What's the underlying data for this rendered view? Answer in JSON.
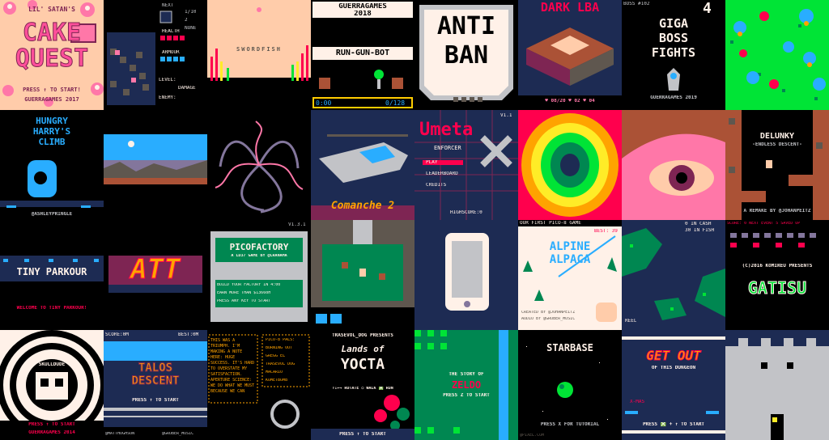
{
  "carts": [
    {
      "id": "cake-quest",
      "title_top": "LIL' SATAN'S",
      "title_a": "CAKE",
      "title_b": "QUEST",
      "prompt": "PRESS ↑ TO START!",
      "credit": "GUERRAGAMES 2017",
      "colors": {
        "bg": "#ff9ec1",
        "title": "#ff4f9a"
      }
    },
    {
      "id": "puzzle-hud",
      "next": "NEXT",
      "count": "1/10",
      "two": "2",
      "none": "NONE",
      "health": "HEALTH",
      "armour": "ARMOUR",
      "level": "LEVEL:",
      "damage": "DAMAGE",
      "enemy": "ENEMY:"
    },
    {
      "id": "swordfish",
      "title": "SWORDFISH",
      "colors": {
        "bg": "#ffc9a8"
      }
    },
    {
      "id": "run-gun-bot",
      "title_a": "GUERRAGAMES",
      "title_b": "2018",
      "subtitle": "RUN-GUN-BOT",
      "score_left": "0:00",
      "score_right": "0/128",
      "colors": {
        "accent": "#ffcc00"
      }
    },
    {
      "id": "anti-ban",
      "title_a": "ANTI",
      "title_b": "BAN",
      "colors": {
        "bg": "#c2c3c7"
      }
    },
    {
      "id": "dark-lba",
      "title": "DARK LBA",
      "hud": "♥ 08/20 ♥ 02 ♥ 04",
      "colors": {
        "title": "#ff004d"
      }
    },
    {
      "id": "giga-boss-fights",
      "corner": "BOSS #102",
      "big": "4",
      "title_a": "GIGA",
      "title_b": "BOSS",
      "title_c": "FIGHTS",
      "credit": "GUERRAGAMES 2019"
    },
    {
      "id": "orbs",
      "colors": {
        "bg": "#00e436"
      }
    },
    {
      "id": "hungry-harry",
      "title_a": "HUNGRY",
      "title_b": "HARRY'S",
      "title_c": "CLIMB",
      "credit": "@ASHLEYPRINGLE"
    },
    {
      "id": "desert-night",
      "colors": {
        "sky": "#29adff"
      }
    },
    {
      "id": "worms",
      "colors": {
        "bg": "#000000"
      }
    },
    {
      "id": "comanche",
      "title": "Comanche 2",
      "colors": {
        "bg": "#1d2b53"
      }
    },
    {
      "id": "umeta-enforcer",
      "title": "Umeta",
      "subtitle": "ENFORCER",
      "version": "V1.1",
      "menu": [
        "PLAY",
        "LEADERBOARD",
        "CREDITS"
      ],
      "highscore": "HIGHSCORE:0"
    },
    {
      "id": "psychedelic",
      "colors": {
        "bg": "#ff004d"
      }
    },
    {
      "id": "eye",
      "colors": {
        "bg": "#ff77a8"
      }
    },
    {
      "id": "delunky",
      "title": "DELUNKY",
      "subtitle": "-ENDLESS DESCENT-",
      "credit": "A REMAKE BY @JOHANPEITZ"
    },
    {
      "id": "tiny-parkour",
      "title": "TINY PARKOUR",
      "welcome": "WELCOME TO TINY PARKOUR!"
    },
    {
      "id": "att",
      "title": "ATT"
    },
    {
      "id": "picofactory",
      "version": "V1.3.1",
      "title": "PICOFACTORY",
      "subtitle": "A LD37 GAME BY @CRANAMA",
      "desc_a": "BUILD YOUR FACTORY IN 4:00",
      "desc_b": "EARN MORE THAN $13660H",
      "desc_c": "PRESS ANY KEY TO START"
    },
    {
      "id": "topdown-dungeon",
      "colors": {
        "bg": "#008751"
      }
    },
    {
      "id": "phone",
      "colors": {
        "bg": "#1d2b53"
      }
    },
    {
      "id": "alpine-alpaca",
      "ticker": "OUR FIRST PICO-8 GAME",
      "best": "BEST: 39",
      "title_a": "ALPINE",
      "title_b": "ALPACA",
      "credit_a": "CREATED BY @JOHANPEITZ",
      "credit_b": "AUDIO BY @GRUBER_MUSIC"
    },
    {
      "id": "fishing",
      "line_a": "0 IN CASH",
      "line_b": "30 IN FISH",
      "reel": "REEL"
    },
    {
      "id": "gatisu",
      "ticker": "SCORE: 0  NEXT EVENT 5 SAVED UP",
      "copyright": "(C)2016 KOMIREU PRESENTS",
      "title": "GATISU"
    },
    {
      "id": "skulldude",
      "title": "SKULLDUDE",
      "prompt": "PRESS ↑ TO START",
      "credit": "GUERRAGAMES 2014"
    },
    {
      "id": "talos-descent",
      "score": "SCORE:0M",
      "best": "BEST:0M",
      "title_a": "TALOS",
      "title_b": "DESCENT",
      "prompt": "PRESS ↑ TO START",
      "credit_a": "@MATTHUGHSON",
      "credit_b": "@GRUBER_MUSIC"
    },
    {
      "id": "portal-text",
      "left": "THIS WAS A TRIUMPH. I'M MAKING A NOTE HERE: HUGE SUCCESS. IT'S HARD TO OVERSTATE MY SATISFACTION. APERTURE SCIENCE: WE DO WHAT WE MUST BECAUSE WE CAN",
      "right_title": "PICO-8 PALS:",
      "right_list": [
        "BURNING OUT",
        "GREGG EL",
        "TRASEVOL DOG",
        "MACARIO",
        "KOMETBOMB"
      ]
    },
    {
      "id": "lands-of-yocta",
      "presenter": "TRASEVOL_DOG PRESENTS",
      "title_a": "Lands of",
      "title_b": "YOCTA",
      "controls": "↑↓←→ ROTATE  ○ WALK  ❎ RUN",
      "prompt": "PRESS ↑ TO START"
    },
    {
      "id": "zeldo",
      "title_a": "THE STORY OF",
      "title_b": "ZELDO",
      "prompt": "PRESS Z TO START"
    },
    {
      "id": "starbase",
      "title": "STARBASE",
      "prompt": "PRESS X FOR TUTORIAL",
      "credit": "@PIXEL.COM"
    },
    {
      "id": "get-out",
      "title_a": "GET OUT",
      "title_b": "OF THIS DUNGEON",
      "xmas": "X-MAS",
      "prompt": "PRESS ❎ + ↑ TO START"
    },
    {
      "id": "castle",
      "colors": {
        "bg": "#1d2b53"
      }
    }
  ]
}
